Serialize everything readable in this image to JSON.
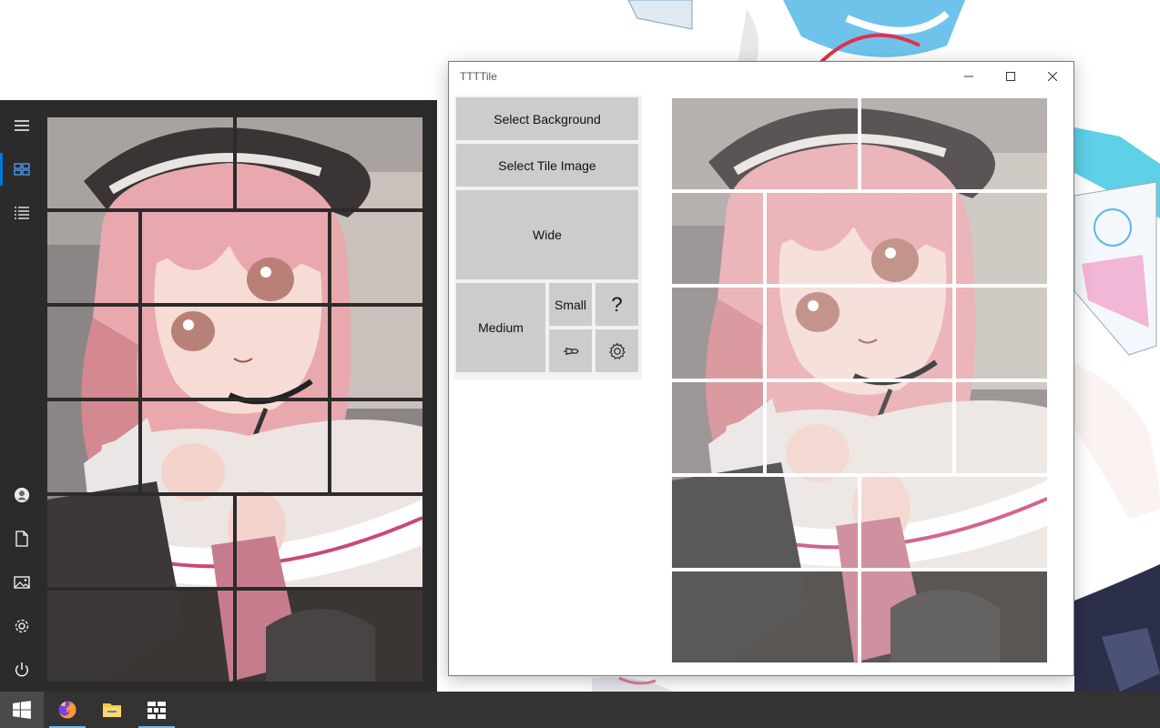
{
  "window": {
    "title": "TTTTile"
  },
  "buttons": {
    "select_background": "Select Background",
    "select_tile_image": "Select Tile Image",
    "wide": "Wide",
    "medium": "Medium",
    "small": "Small",
    "help": "?"
  },
  "start_menu": {
    "rail_icons": [
      "hamburger-icon",
      "tiles-icon",
      "all-apps-list-icon",
      "user-icon",
      "documents-icon",
      "pictures-icon",
      "settings-icon",
      "power-icon"
    ]
  },
  "taskbar": {
    "apps": [
      "windows-start-icon",
      "firefox-icon",
      "file-explorer-icon",
      "ttttile-app-icon"
    ]
  },
  "colors": {
    "accent": "#0078d7",
    "tile_gray": "#cccccc",
    "start_menu_bg": "#2b2b2b",
    "taskbar_bg": "#333333",
    "hair_pink": "#e9a8ae"
  }
}
